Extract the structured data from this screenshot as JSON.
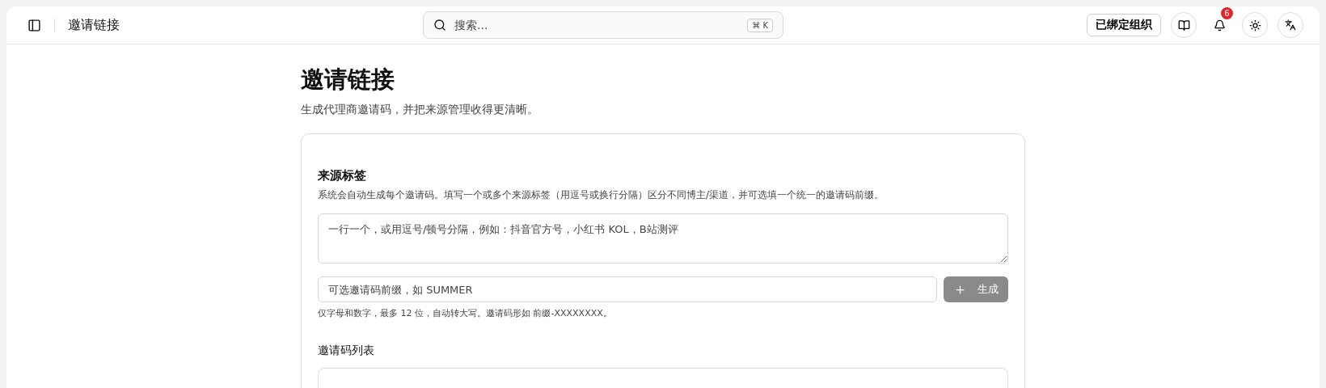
{
  "header": {
    "title": "邀请链接",
    "search": {
      "placeholder": "搜索...",
      "shortcut": "⌘ K"
    },
    "org_button": "已绑定组织",
    "notifications": {
      "count": "6"
    }
  },
  "page": {
    "title": "邀请链接",
    "subtitle": "生成代理商邀请码，并把来源管理收得更清晰。"
  },
  "card": {
    "section_title": "来源标签",
    "description": "系统会自动生成每个邀请码。填写一个或多个来源标签（用逗号或换行分隔）区分不同博主/渠道，并可选填一个统一的邀请码前缀。",
    "tags_field": {
      "placeholder": "一行一个，或用逗号/顿号分隔，例如：抖音官方号，小红书 KOL，B站测评"
    },
    "prefix_field": {
      "placeholder": "可选邀请码前缀，如 SUMMER"
    },
    "generate_button": {
      "label": "生成",
      "disabled": true
    },
    "hint": "仅字母和数字，最多 12 位，自动转大写。邀请码形如 前缀-XXXXXXXX。",
    "list_title": "邀请码列表"
  }
}
